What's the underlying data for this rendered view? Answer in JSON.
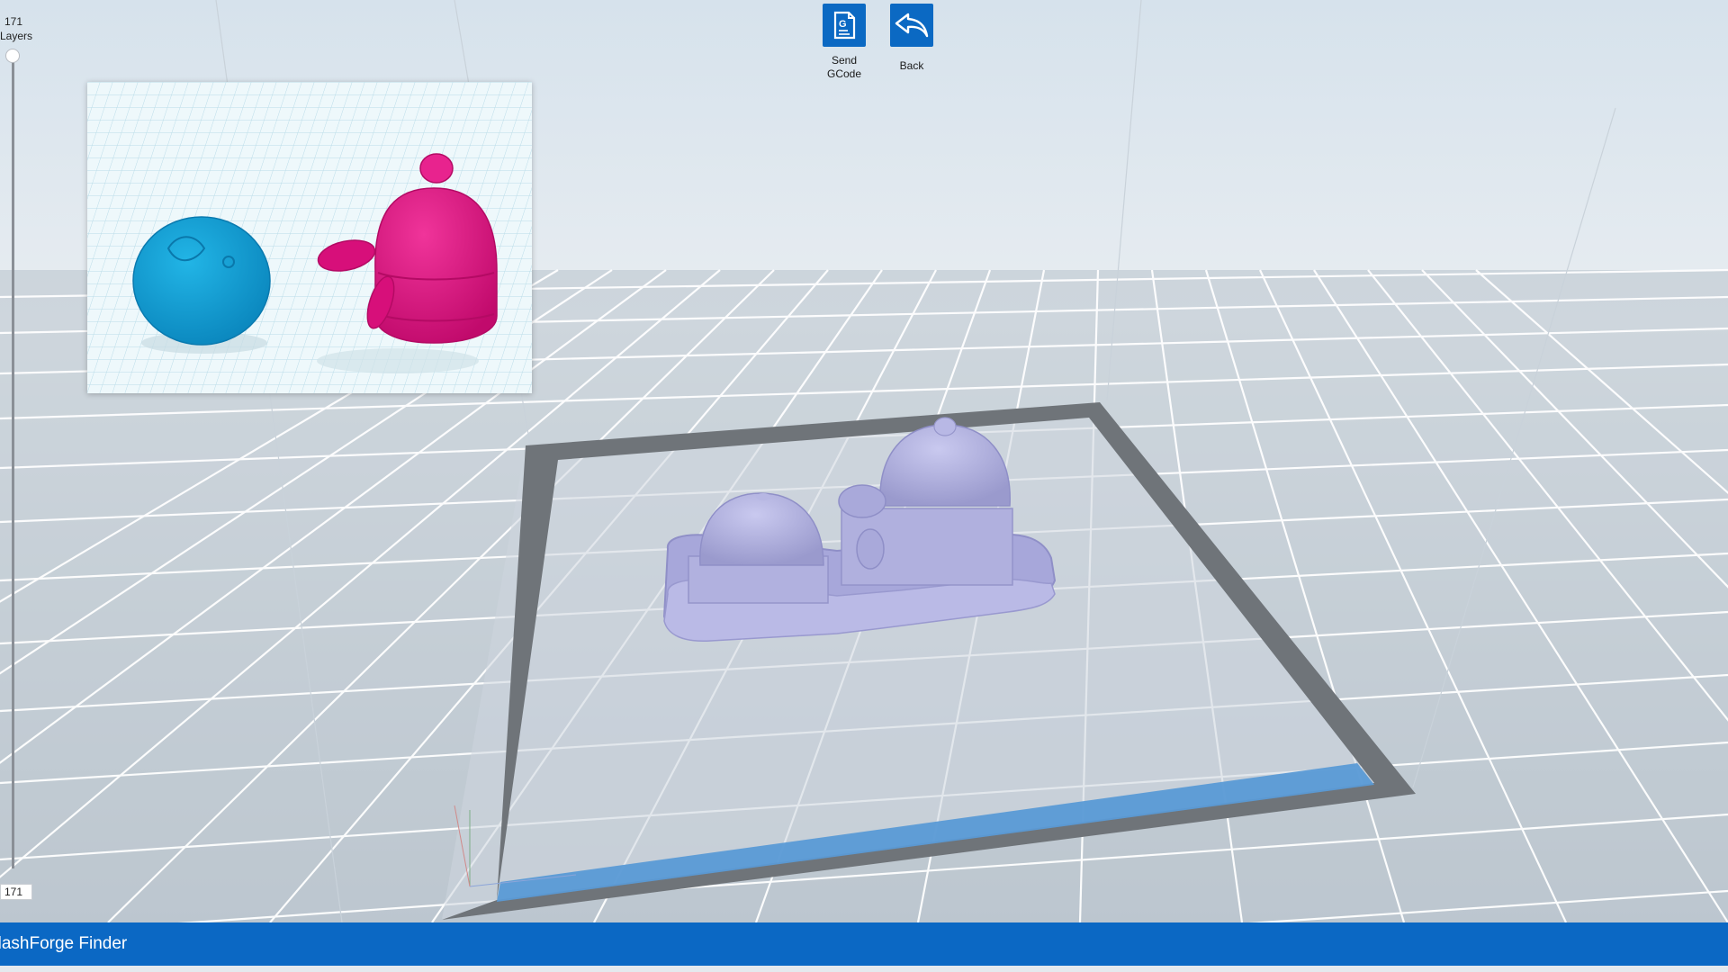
{
  "app": {
    "title": "FlashForge Finder"
  },
  "layers": {
    "max": 171,
    "label": "Layers",
    "current_value": "171"
  },
  "toolbar": {
    "send_gcode_label_line1": "Send",
    "send_gcode_label_line2": "GCode",
    "back_label": "Back",
    "gcode_icon_letter": "G"
  },
  "colors": {
    "accent": "#0b68c4",
    "model_preview": "#b3b3e0",
    "preview_blue_part": "#0c98cf",
    "preview_pink_part": "#e0117f",
    "build_plate_border": "#6f7479",
    "build_plate_front": "#5a9ad6"
  },
  "icons": {
    "send_gcode": "gcode-file-icon",
    "back": "reply-arrow-icon"
  }
}
